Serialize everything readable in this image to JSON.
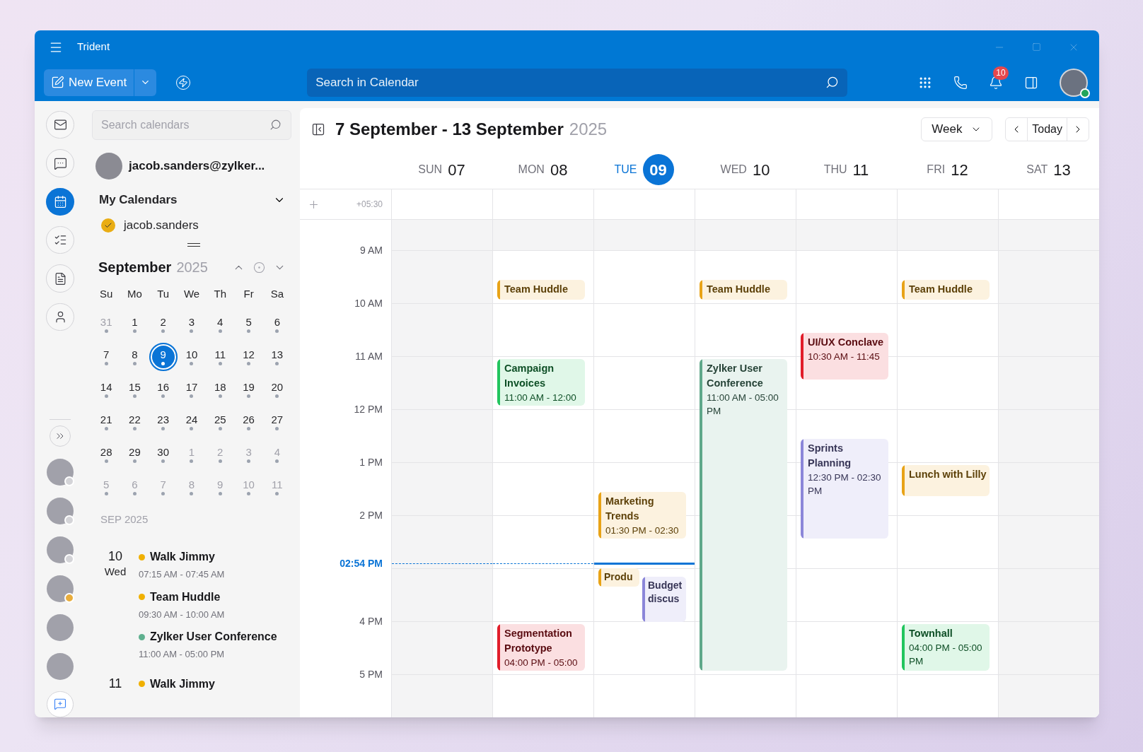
{
  "window": {
    "title": "Trident"
  },
  "toolbar": {
    "new_event": "New Event",
    "search": {
      "placeholder": "Search in Calendar"
    },
    "notification_count": "10"
  },
  "rail": {
    "apps": [
      {
        "selected": false
      },
      {
        "selected": false
      },
      {
        "selected": true
      },
      {
        "selected": false
      },
      {
        "selected": false
      },
      {
        "selected": false
      }
    ],
    "contacts": [
      {
        "status_dot": true,
        "color": "#d4d4d8"
      },
      {
        "status_dot": true,
        "color": "#d4d4d8"
      },
      {
        "status_dot": true,
        "color": "#d4d4d8"
      },
      {
        "status_dot": true,
        "color": "#e9ad3c"
      },
      {
        "status_dot": false
      },
      {
        "status_dot": false
      }
    ]
  },
  "sidebar": {
    "search": {
      "placeholder": "Search calendars"
    },
    "account": "jacob.sanders@zylker...",
    "my_calendars": {
      "title": "My Calendars",
      "expanded": true,
      "items": [
        {
          "name": "jacob.sanders",
          "checked": true,
          "color": "#e9ad14"
        }
      ]
    },
    "mini_calendar": {
      "month": "September",
      "year": "2025",
      "weekdays": [
        "Su",
        "Mo",
        "Tu",
        "We",
        "Th",
        "Fr",
        "Sa"
      ],
      "weeks": [
        [
          {
            "label": "31",
            "muted": true,
            "selected": false
          },
          {
            "label": "1",
            "muted": false,
            "selected": false
          },
          {
            "label": "2",
            "muted": false,
            "selected": false
          },
          {
            "label": "3",
            "muted": false,
            "selected": false
          },
          {
            "label": "4",
            "muted": false,
            "selected": false
          },
          {
            "label": "5",
            "muted": false,
            "selected": false
          },
          {
            "label": "6",
            "muted": false,
            "selected": false
          }
        ],
        [
          {
            "label": "7",
            "muted": false,
            "selected": false
          },
          {
            "label": "8",
            "muted": false,
            "selected": false
          },
          {
            "label": "9",
            "muted": false,
            "selected": true
          },
          {
            "label": "10",
            "muted": false,
            "selected": false
          },
          {
            "label": "11",
            "muted": false,
            "selected": false
          },
          {
            "label": "12",
            "muted": false,
            "selected": false
          },
          {
            "label": "13",
            "muted": false,
            "selected": false
          }
        ],
        [
          {
            "label": "14",
            "muted": false,
            "selected": false
          },
          {
            "label": "15",
            "muted": false,
            "selected": false
          },
          {
            "label": "16",
            "muted": false,
            "selected": false
          },
          {
            "label": "17",
            "muted": false,
            "selected": false
          },
          {
            "label": "18",
            "muted": false,
            "selected": false
          },
          {
            "label": "19",
            "muted": false,
            "selected": false
          },
          {
            "label": "20",
            "muted": false,
            "selected": false
          }
        ],
        [
          {
            "label": "21",
            "muted": false,
            "selected": false
          },
          {
            "label": "22",
            "muted": false,
            "selected": false
          },
          {
            "label": "23",
            "muted": false,
            "selected": false
          },
          {
            "label": "24",
            "muted": false,
            "selected": false
          },
          {
            "label": "25",
            "muted": false,
            "selected": false
          },
          {
            "label": "26",
            "muted": false,
            "selected": false
          },
          {
            "label": "27",
            "muted": false,
            "selected": false
          }
        ],
        [
          {
            "label": "28",
            "muted": false,
            "selected": false
          },
          {
            "label": "29",
            "muted": false,
            "selected": false
          },
          {
            "label": "30",
            "muted": false,
            "selected": false
          },
          {
            "label": "1",
            "muted": true,
            "selected": false
          },
          {
            "label": "2",
            "muted": true,
            "selected": false
          },
          {
            "label": "3",
            "muted": true,
            "selected": false
          },
          {
            "label": "4",
            "muted": true,
            "selected": false
          }
        ],
        [
          {
            "label": "5",
            "muted": true,
            "selected": false
          },
          {
            "label": "6",
            "muted": true,
            "selected": false
          },
          {
            "label": "7",
            "muted": true,
            "selected": false
          },
          {
            "label": "8",
            "muted": true,
            "selected": false
          },
          {
            "label": "9",
            "muted": true,
            "selected": false
          },
          {
            "label": "10",
            "muted": true,
            "selected": false
          },
          {
            "label": "11",
            "muted": true,
            "selected": false
          }
        ]
      ]
    },
    "agenda": {
      "header": "SEP 2025",
      "groups": [
        {
          "day": "10",
          "weekday": "Wed",
          "events": [
            {
              "title": "Walk Jimmy",
              "time": "07:15 AM - 07:45 AM",
              "color": "#f0b000"
            },
            {
              "title": "Team Huddle",
              "time": "09:30 AM - 10:00 AM",
              "color": "#f0b000"
            },
            {
              "title": "Zylker User Conference",
              "time": "11:00 AM - 05:00 PM",
              "color": "#5fb08f"
            }
          ]
        },
        {
          "day": "11",
          "events": [
            {
              "title": "Walk Jimmy",
              "color": "#f0b000"
            }
          ]
        }
      ]
    }
  },
  "calendar": {
    "range": "7 September - 13 September",
    "year": "2025",
    "view": "Week",
    "today_button": "Today",
    "timezone": "+05:30",
    "time_labels": [
      "9 AM",
      "10 AM",
      "11 AM",
      "12 PM",
      "1 PM",
      "2 PM",
      "4 PM",
      "5 PM"
    ],
    "now_label": "02:54 PM",
    "days": [
      {
        "dow": "SUN",
        "date": "07",
        "today": false,
        "off": true
      },
      {
        "dow": "MON",
        "date": "08",
        "today": false,
        "off": false,
        "events": [
          {
            "title": "Team Huddle",
            "color": "#e8a317"
          },
          {
            "title": "Campaign Invoices",
            "time": "11:00 AM - 12:00",
            "color": "#22c55e"
          },
          {
            "title": "Segmentation Prototype",
            "time": "04:00 PM - 05:00",
            "color": "#e11d2a"
          }
        ]
      },
      {
        "dow": "TUE",
        "date": "09",
        "today": true,
        "off": false,
        "events": [
          {
            "title": "Marketing Trends",
            "time": "01:30 PM - 02:30",
            "color": "#e8a317"
          },
          {
            "title": "Produ",
            "color": "#e8a317"
          },
          {
            "title": "Budget discus",
            "color": "#8b86d9"
          }
        ]
      },
      {
        "dow": "WED",
        "date": "10",
        "today": false,
        "off": false,
        "events": [
          {
            "title": "Team Huddle",
            "color": "#e8a317"
          },
          {
            "title": "Zylker User Conference",
            "time": "11:00 AM - 05:00 PM",
            "color": "#5fa88a"
          }
        ]
      },
      {
        "dow": "THU",
        "date": "11",
        "today": false,
        "off": false,
        "events": [
          {
            "title": "UI/UX Conclave",
            "time": "10:30 AM - 11:45",
            "color": "#e11d2a"
          },
          {
            "title": "Sprints Planning",
            "time": "12:30 PM - 02:30 PM",
            "color": "#8b86d9"
          }
        ]
      },
      {
        "dow": "FRI",
        "date": "12",
        "today": false,
        "off": false,
        "events": [
          {
            "title": "Team Huddle",
            "color": "#e8a317"
          },
          {
            "title": "Lunch with Lilly",
            "color": "#e8a317"
          },
          {
            "title": "Townhall",
            "time": "04:00 PM - 05:00 PM",
            "color": "#22c55e"
          }
        ]
      },
      {
        "dow": "SAT",
        "date": "13",
        "today": false,
        "off": true
      }
    ]
  }
}
